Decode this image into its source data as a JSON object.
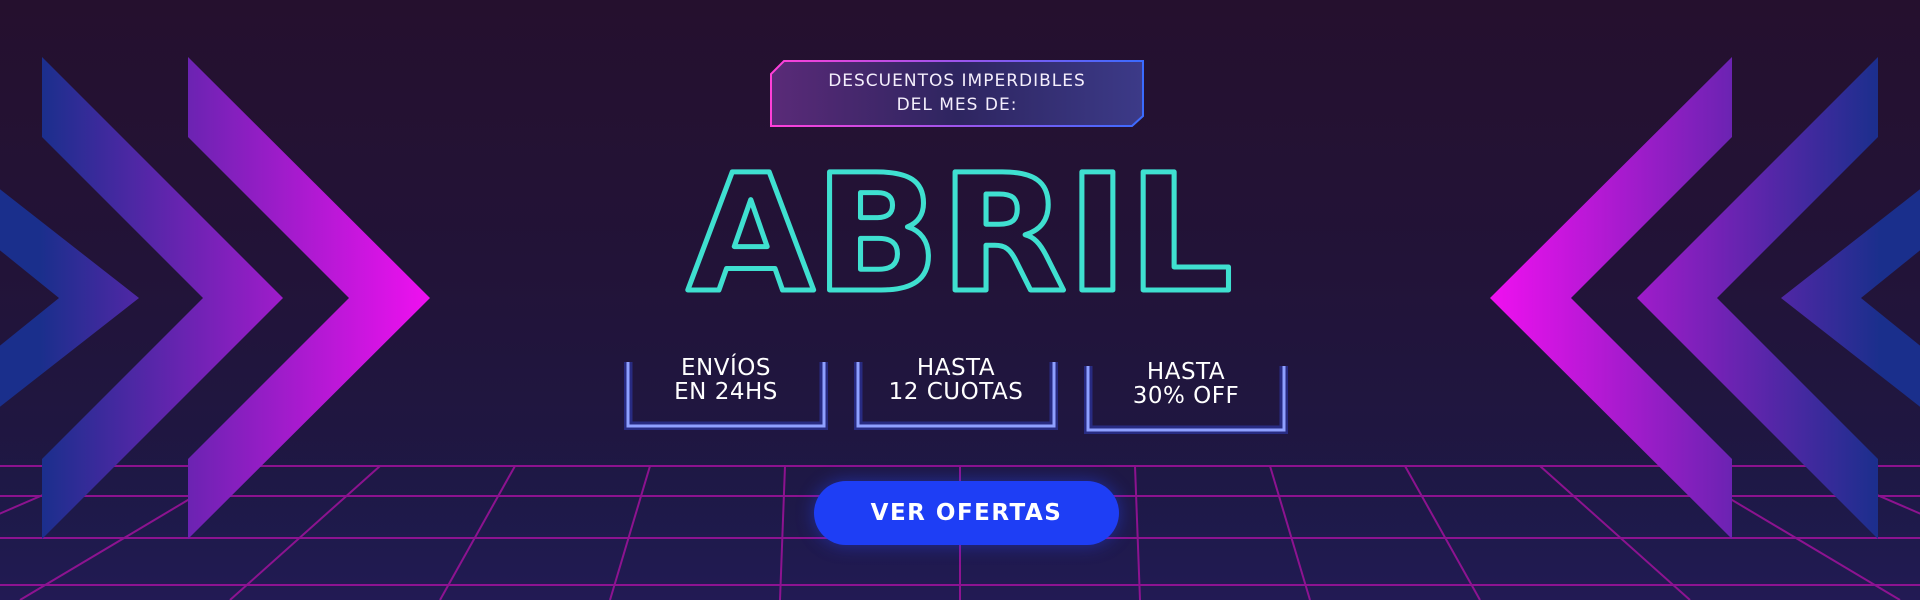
{
  "banner": {
    "eyebrow": {
      "line1": "DESCUENTOS IMPERDIBLES",
      "line2": "DEL MES DE:"
    },
    "month_title": "ABRIL",
    "features": [
      {
        "line1": "ENVÍOS",
        "line2": "EN 24HS"
      },
      {
        "line1": "HASTA",
        "line2": "12 CUOTAS"
      },
      {
        "line1": "HASTA",
        "line2": "30% OFF"
      }
    ],
    "cta_label": "VER OFERTAS"
  },
  "colors": {
    "background_top": "#25102e",
    "background_bottom": "#1c1a4a",
    "chevron_magenta": "#f010f0",
    "chevron_blue": "#1a2f8c",
    "title_teal": "#3fe0d0",
    "neon_blue": "#3a52ff",
    "cta_blue": "#1e3ef5",
    "grid_magenta": "#a0129c"
  },
  "icons": {
    "left_decoration": "chevrons-right-icon",
    "right_decoration": "chevrons-left-icon"
  }
}
